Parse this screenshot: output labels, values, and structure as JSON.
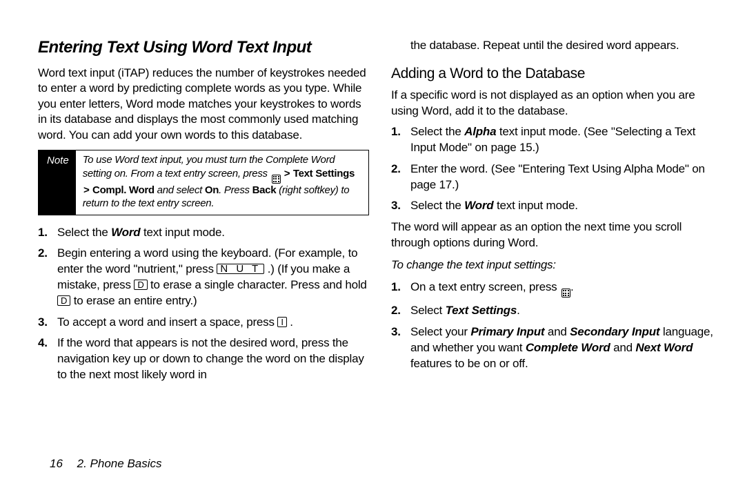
{
  "left": {
    "h1": "Entering Text Using Word Text Input",
    "intro": "Word text input (iTAP) reduces the number of keystrokes needed to enter a word by predicting complete words as you type. While you enter letters, Word mode matches your keystrokes to words in its database and displays the most commonly used matching word. You can add your own words to this database.",
    "note": {
      "label": "Note",
      "part1": "To use Word text input, you must turn the Complete Word setting on. From a text entry screen, press ",
      "bold1": "Text Settings",
      "bold2": "Compl. Word",
      "mid1": " and select ",
      "bold3": "On",
      "mid2": ". Press ",
      "bold4": "Back",
      "part2": " (right softkey) to return to the text entry screen."
    },
    "steps": {
      "s1a": "Select the ",
      "s1b": "Word",
      "s1c": " text input mode.",
      "s2a": "Begin entering a word using the keyboard. (For example, to enter the word \"nutrient,\" press ",
      "s2keys": "N U T",
      "s2b": " .) (If you make a mistake, press ",
      "s2key2": "D",
      "s2c": " to erase a single character. Press and hold ",
      "s2key3": "D",
      "s2d": " to erase an entire entry.)",
      "s3a": "To accept a word and insert a space, press ",
      "s3key": "I",
      "s3b": " .",
      "s4": "If the word that appears is not the desired word, press the navigation key up or down to change the word on the display to the next most likely word in"
    }
  },
  "right": {
    "cont": "the database. Repeat until the desired word appears.",
    "h2": "Adding a Word to the Database",
    "intro2": "If a specific word is not displayed as an option when you are using Word, add it to the database.",
    "steps2": {
      "s1a": "Select the ",
      "s1b": "Alpha",
      "s1c": " text input mode. (See \"Selecting a Text Input Mode\" on page 15.)",
      "s2": "Enter the word. (See \"Entering Text Using Alpha Mode\" on page 17.)",
      "s3a": "Select the ",
      "s3b": "Word",
      "s3c": " text input mode."
    },
    "after": "The word will appear as an option the next time you scroll through options during Word.",
    "subhead": "To change the text input settings:",
    "steps3": {
      "s1a": "On a text entry screen, press ",
      "s1b": ".",
      "s2a": "Select ",
      "s2b": "Text Settings",
      "s2c": ".",
      "s3a": "Select your ",
      "s3b": "Primary Input",
      "s3c": " and ",
      "s3d": "Secondary Input",
      "s3e": " language, and whether you want ",
      "s3f": "Complete Word",
      "s3g": " and ",
      "s3h": "Next Word",
      "s3i": " features to be on or off."
    }
  },
  "footer": {
    "page": "16",
    "chapter": "2. Phone Basics"
  }
}
